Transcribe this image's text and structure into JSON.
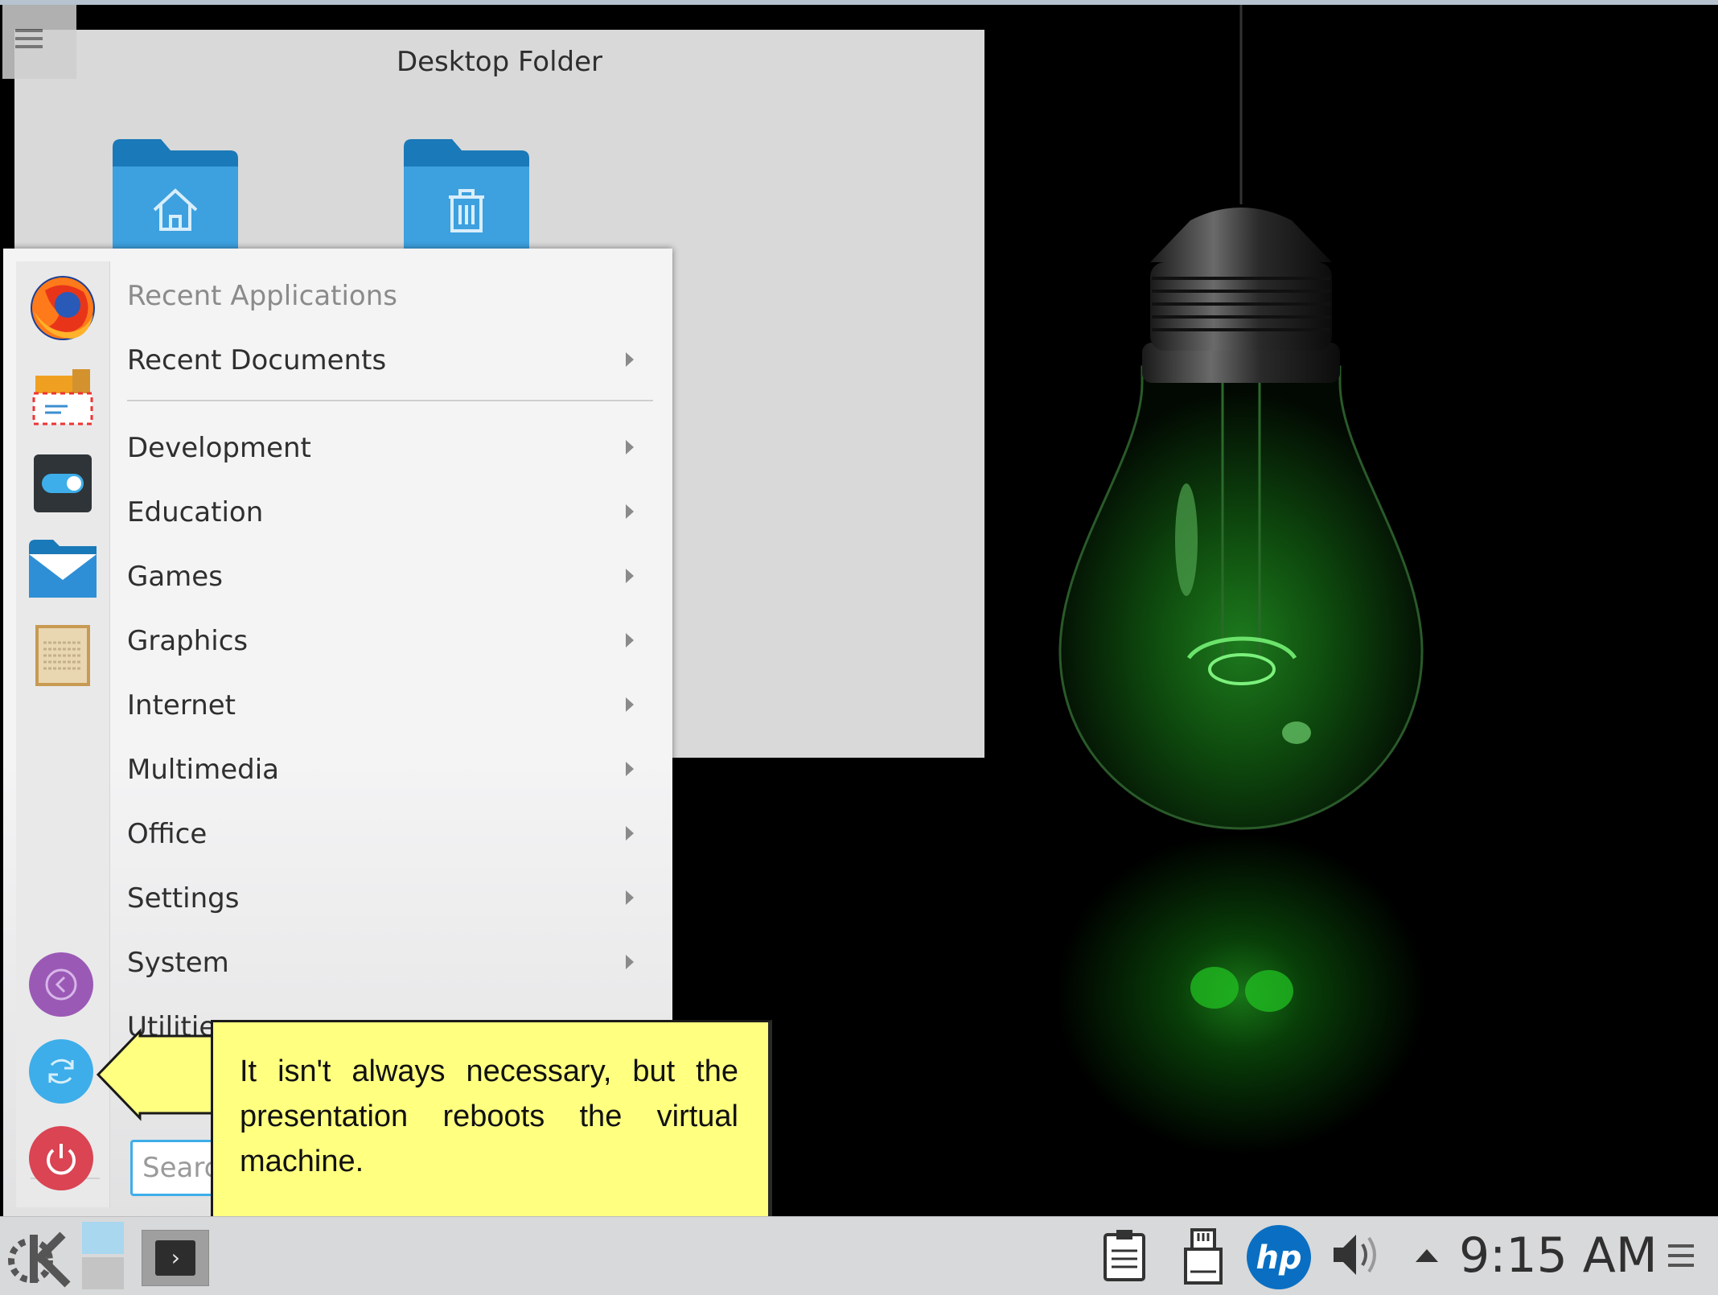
{
  "desktop": {
    "folder_widget": {
      "title": "Desktop Folder",
      "icons": [
        "home-folder",
        "trash-folder"
      ]
    }
  },
  "kickoff_menu": {
    "favorites": [
      "firefox",
      "mail-composer",
      "system-settings-toggle",
      "kmail",
      "text-editor"
    ],
    "categories": [
      {
        "label": "Recent Applications",
        "submenu": false
      },
      {
        "label": "Recent Documents",
        "submenu": true
      },
      {
        "label": "Development",
        "submenu": true
      },
      {
        "label": "Education",
        "submenu": true
      },
      {
        "label": "Games",
        "submenu": true
      },
      {
        "label": "Graphics",
        "submenu": true
      },
      {
        "label": "Internet",
        "submenu": true
      },
      {
        "label": "Multimedia",
        "submenu": true
      },
      {
        "label": "Office",
        "submenu": true
      },
      {
        "label": "Settings",
        "submenu": true
      },
      {
        "label": "System",
        "submenu": true
      },
      {
        "label": "Utilitie",
        "submenu": false
      }
    ],
    "search_placeholder": "Searc",
    "session_buttons": [
      "back",
      "reboot",
      "shutdown"
    ],
    "colors": {
      "back": "#9b59b6",
      "reboot": "#3daee9",
      "shutdown": "#da4453"
    }
  },
  "callout": {
    "text": "It isn't always necessary, but the presentation reboots the virtual machine.",
    "background": "#ffff80"
  },
  "taskbar": {
    "clock": "9:15 AM",
    "tray_icons": [
      "clipboard-icon",
      "removable-device-icon",
      "hp-icon",
      "volume-icon",
      "expand-tray-icon",
      "panel-menu-icon"
    ]
  }
}
